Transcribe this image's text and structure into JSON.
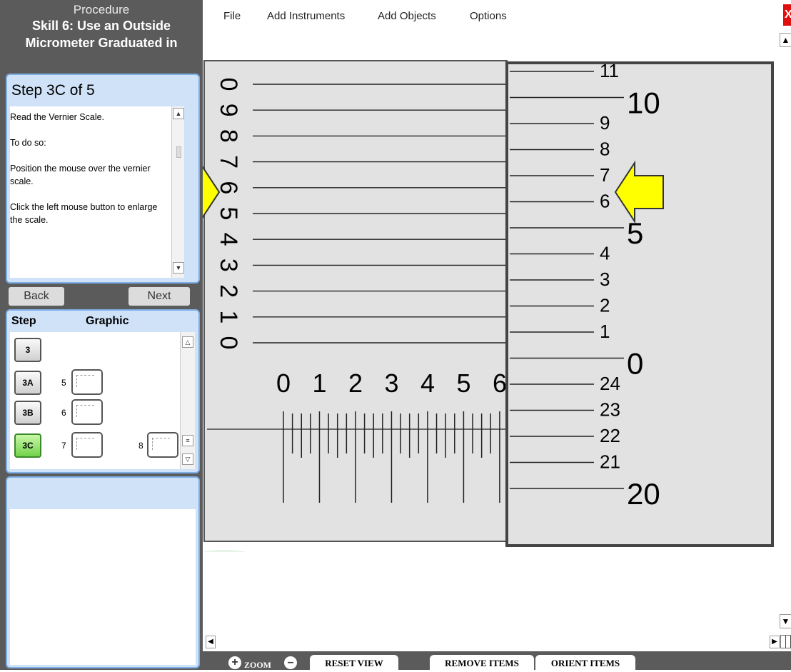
{
  "procedure": {
    "heading": "Procedure",
    "title_line1": "Skill 6: Use an Outside",
    "title_line2": "Micrometer Graduated in"
  },
  "step_panel": {
    "step_label": "Step 3C of 5",
    "instructions": [
      "Read the Vernier Scale.",
      "To do so:",
      "Position the mouse over the vernier scale.",
      "Click the left mouse button to enlarge the scale."
    ]
  },
  "nav": {
    "back_label": "Back",
    "next_label": "Next"
  },
  "steps_grid": {
    "col_step": "Step",
    "col_graphic": "Graphic",
    "rows": [
      {
        "step": "3",
        "graphics": []
      },
      {
        "step": "3A",
        "graphics": [
          "5"
        ]
      },
      {
        "step": "3B",
        "graphics": [
          "6"
        ]
      },
      {
        "step": "3C",
        "graphics": [
          "7",
          "8"
        ],
        "active": true
      }
    ]
  },
  "menu": {
    "file": "File",
    "add_instruments": "Add Instruments",
    "add_objects": "Add Objects",
    "options": "Options"
  },
  "close_label": "X",
  "scale": {
    "vernier_digits": [
      "0",
      "9",
      "8",
      "7",
      "6",
      "5",
      "4",
      "3",
      "2",
      "1",
      "0"
    ],
    "sleeve_digits": [
      "0",
      "1",
      "2",
      "3",
      "4",
      "5",
      "6"
    ],
    "thimble_labels": [
      "11",
      "10",
      "9",
      "8",
      "7",
      "6",
      "5",
      "4",
      "3",
      "2",
      "1",
      "0",
      "24",
      "23",
      "22",
      "21",
      "20"
    ]
  },
  "toolbar": {
    "zoom_label": "ZOOM",
    "zoom_in": "+",
    "zoom_out": "–",
    "reset_view": "RESET VIEW",
    "remove_items": "REMOVE ITEMS",
    "orient_items": "ORIENT ITEMS"
  },
  "colors": {
    "arrow_fill": "#ffff00",
    "active_step": "#72d24b",
    "panel_blue": "#cfe2f8",
    "close_red": "#e01010"
  }
}
